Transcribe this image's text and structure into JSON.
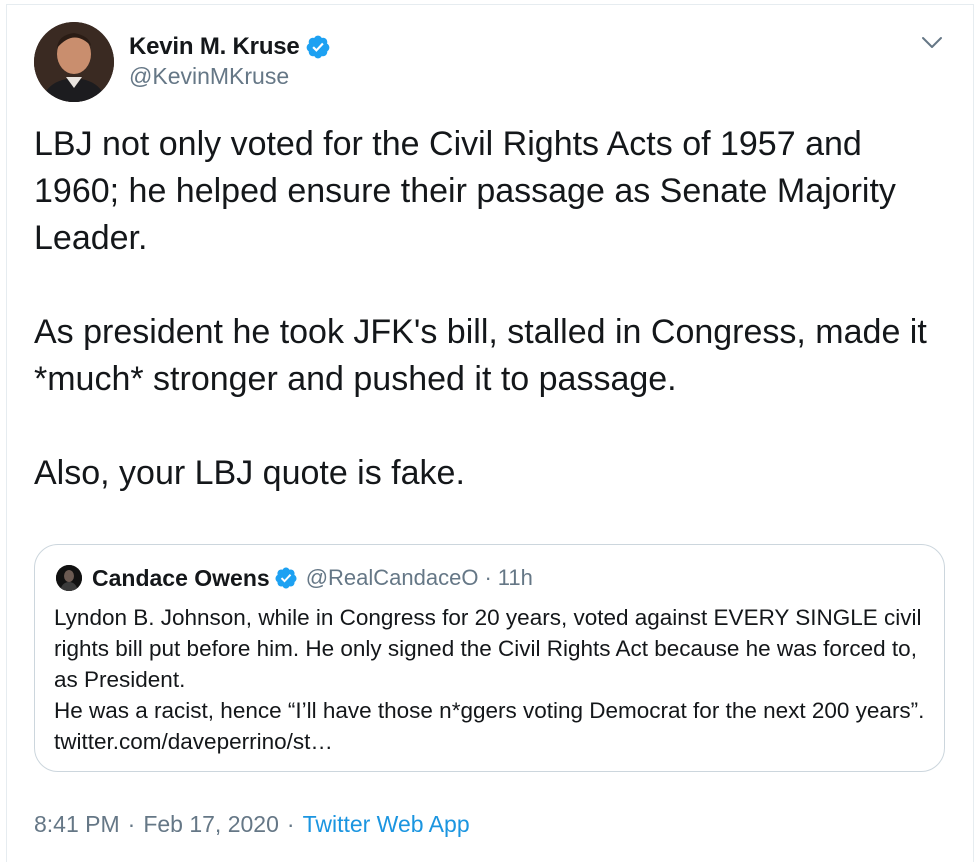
{
  "tweet": {
    "author": {
      "name": "Kevin M. Kruse",
      "handle": "@KevinMKruse",
      "verified": true,
      "avatar_icon": "profile-photo"
    },
    "body": [
      "LBJ not only voted for the Civil Rights Acts of 1957 and 1960; he helped ensure their passage as Senate Majority Leader.",
      "As president he took JFK's bill, stalled in Congress, made it *much* stronger and pushed it to passage.",
      "Also, your LBJ quote is fake."
    ],
    "quoted": {
      "name": "Candace Owens",
      "handle": "@RealCandaceO",
      "separator": "·",
      "time": "11h",
      "verified": true,
      "lines": [
        "Lyndon B. Johnson, while in Congress for 20 years, voted against EVERY SINGLE civil rights bill put before him. He only signed the Civil Rights Act because he was forced to, as President.",
        "He was a racist, hence “I’ll have those n*ggers voting Democrat for the next 200 years”. twitter.com/daveperrino/st…"
      ]
    },
    "meta": {
      "time": "8:41 PM",
      "separator": "·",
      "date": "Feb 17, 2020",
      "source": "Twitter Web App"
    }
  },
  "colors": {
    "text": "#14171a",
    "secondary": "#657786",
    "link": "#1b95e0",
    "verified": "#1da1f2",
    "border": "#ccd6dd"
  }
}
